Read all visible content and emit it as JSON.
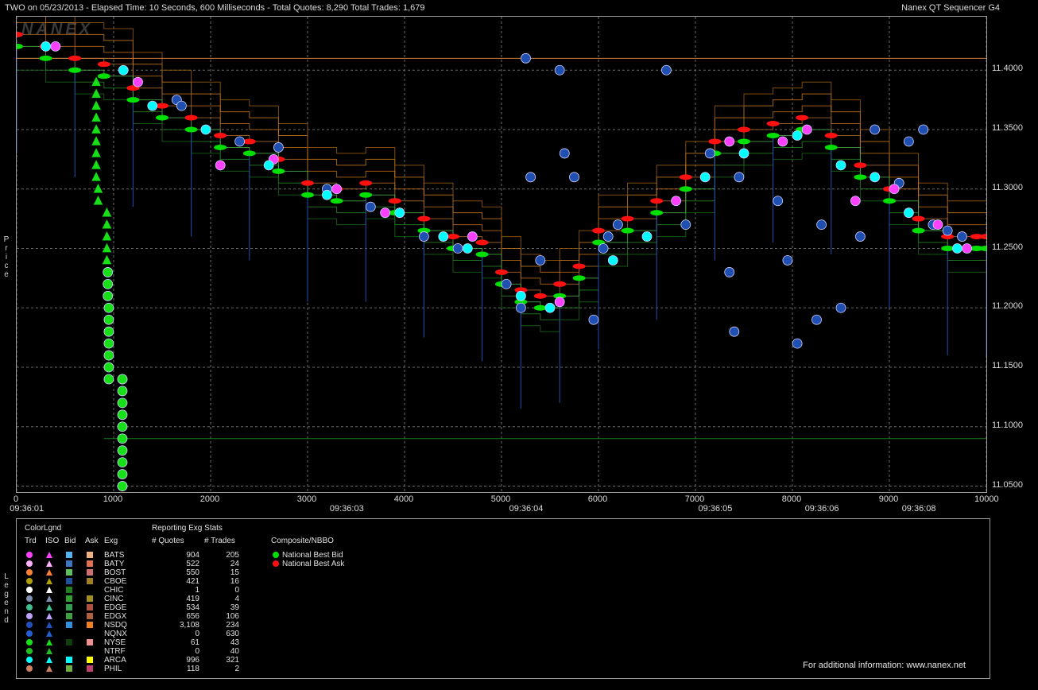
{
  "header": {
    "title": "TWO on 05/23/2013  -  Elapsed Time: 10 Seconds, 600 Milliseconds  -  Total Quotes: 8,290  Total Trades: 1,679",
    "app": "Nanex QT Sequencer G4"
  },
  "side_labels": {
    "price": "Price",
    "legend": "Legend"
  },
  "watermark": "NANEX",
  "chart_data": {
    "type": "scatter",
    "title": "",
    "xlabel": "",
    "ylabel": "Price",
    "xlim": [
      0,
      10000
    ],
    "ylim": [
      11.045,
      11.445
    ],
    "x_ticks": [
      0,
      1000,
      2000,
      3000,
      4000,
      5000,
      6000,
      7000,
      8000,
      9000,
      10000
    ],
    "y_ticks": [
      11.05,
      11.1,
      11.15,
      11.2,
      11.25,
      11.3,
      11.35,
      11.4
    ],
    "y_tick_labels": [
      "11.0500",
      "11.1000",
      "11.1500",
      "11.2000",
      "11.2500",
      "11.3000",
      "11.3500",
      "11.4000"
    ],
    "time_labels": [
      {
        "x": 150,
        "label": "09:36:01"
      },
      {
        "x": 3450,
        "label": "09:36:03"
      },
      {
        "x": 5300,
        "label": "09:36:04"
      },
      {
        "x": 7250,
        "label": "09:36:05"
      },
      {
        "x": 8350,
        "label": "09:36:06"
      },
      {
        "x": 9350,
        "label": "09:36:08"
      }
    ],
    "grid": true,
    "series": [
      {
        "name": "National Best Bid",
        "color": "#00e000",
        "x": [
          0,
          300,
          600,
          900,
          1200,
          1500,
          1800,
          2100,
          2400,
          2700,
          3000,
          3300,
          3600,
          3900,
          4200,
          4500,
          4800,
          5000,
          5200,
          5400,
          5600,
          5800,
          6000,
          6300,
          6600,
          6900,
          7200,
          7500,
          7800,
          8100,
          8400,
          8700,
          9000,
          9300,
          9600,
          9900,
          10000
        ],
        "y": [
          11.42,
          11.41,
          11.4,
          11.395,
          11.375,
          11.36,
          11.35,
          11.335,
          11.33,
          11.315,
          11.295,
          11.29,
          11.295,
          11.28,
          11.265,
          11.25,
          11.245,
          11.22,
          11.205,
          11.2,
          11.21,
          11.225,
          11.255,
          11.265,
          11.28,
          11.3,
          11.33,
          11.34,
          11.345,
          11.35,
          11.335,
          11.31,
          11.29,
          11.265,
          11.25,
          11.25,
          11.25
        ]
      },
      {
        "name": "National Best Ask",
        "color": "#ff1010",
        "x": [
          0,
          300,
          600,
          900,
          1200,
          1500,
          1800,
          2100,
          2400,
          2700,
          3000,
          3300,
          3600,
          3900,
          4200,
          4500,
          4800,
          5000,
          5200,
          5400,
          5600,
          5800,
          6000,
          6300,
          6600,
          6900,
          7200,
          7500,
          7800,
          8100,
          8400,
          8700,
          9000,
          9300,
          9600,
          9900,
          10000
        ],
        "y": [
          11.43,
          11.42,
          11.41,
          11.405,
          11.385,
          11.37,
          11.36,
          11.345,
          11.34,
          11.325,
          11.305,
          11.3,
          11.305,
          11.29,
          11.275,
          11.26,
          11.255,
          11.23,
          11.215,
          11.21,
          11.22,
          11.235,
          11.265,
          11.275,
          11.29,
          11.31,
          11.34,
          11.35,
          11.355,
          11.36,
          11.345,
          11.32,
          11.3,
          11.275,
          11.26,
          11.26,
          11.26
        ]
      },
      {
        "name": "NSDQ Trades",
        "color": "#1f4fb0",
        "x": [
          1650,
          1700,
          2300,
          2700,
          3200,
          3650,
          4200,
          4550,
          5050,
          5200,
          5250,
          5300,
          5400,
          5600,
          5650,
          5750,
          5950,
          6050,
          6100,
          6200,
          6700,
          6900,
          7150,
          7350,
          7400,
          7450,
          7850,
          7950,
          8050,
          8250,
          8300,
          8500,
          8700,
          8850,
          9100,
          9200,
          9350,
          9450,
          9600,
          9750
        ],
        "y": [
          11.375,
          11.37,
          11.34,
          11.335,
          11.3,
          11.285,
          11.26,
          11.25,
          11.22,
          11.2,
          11.41,
          11.31,
          11.24,
          11.4,
          11.33,
          11.31,
          11.19,
          11.25,
          11.26,
          11.27,
          11.4,
          11.27,
          11.33,
          11.23,
          11.18,
          11.31,
          11.29,
          11.24,
          11.17,
          11.19,
          11.27,
          11.2,
          11.26,
          11.35,
          11.305,
          11.34,
          11.35,
          11.27,
          11.265,
          11.26
        ]
      },
      {
        "name": "BATS Trades",
        "color": "#ff40ff",
        "x": [
          400,
          1250,
          2100,
          2650,
          3300,
          3800,
          4700,
          5600,
          6800,
          7350,
          7900,
          8150,
          8650,
          9050,
          9500,
          9800
        ],
        "y": [
          11.42,
          11.39,
          11.32,
          11.325,
          11.3,
          11.28,
          11.26,
          11.205,
          11.29,
          11.34,
          11.34,
          11.35,
          11.29,
          11.3,
          11.27,
          11.25
        ]
      },
      {
        "name": "ARCA Trades",
        "color": "#00ffff",
        "x": [
          300,
          1100,
          1400,
          1950,
          2600,
          3200,
          3950,
          4400,
          4650,
          5200,
          5500,
          6150,
          6500,
          7100,
          7500,
          8050,
          8500,
          8850,
          9200,
          9700
        ],
        "y": [
          11.42,
          11.4,
          11.37,
          11.35,
          11.32,
          11.295,
          11.28,
          11.26,
          11.25,
          11.21,
          11.2,
          11.24,
          11.26,
          11.31,
          11.33,
          11.345,
          11.32,
          11.31,
          11.28,
          11.25
        ]
      },
      {
        "name": "NYSE Trades",
        "color": "#18e018",
        "x": [
          940,
          940,
          940,
          950,
          950,
          950,
          950,
          950,
          950,
          950,
          1090,
          1090,
          1090,
          1090,
          1090,
          1090,
          1090,
          1090,
          1090,
          1090,
          1090,
          1090
        ],
        "y": [
          11.23,
          11.22,
          11.21,
          11.2,
          11.19,
          11.18,
          11.17,
          11.16,
          11.15,
          11.14,
          11.14,
          11.13,
          11.12,
          11.11,
          11.1,
          11.09,
          11.08,
          11.07,
          11.06,
          11.05,
          11.14,
          11.05
        ]
      },
      {
        "name": "NYSE ISO",
        "color": "#18e018",
        "x": [
          820,
          820,
          820,
          820,
          820,
          820,
          820,
          820,
          820,
          840,
          840,
          930,
          930,
          930,
          930,
          930
        ],
        "y": [
          11.39,
          11.38,
          11.37,
          11.36,
          11.35,
          11.34,
          11.33,
          11.32,
          11.31,
          11.3,
          11.29,
          11.28,
          11.27,
          11.26,
          11.25,
          11.24
        ]
      }
    ]
  },
  "legend": {
    "section_title": "ColorLgnd",
    "columns": [
      "Trd",
      "ISO",
      "Bid",
      "Ask",
      "Exg"
    ],
    "stats_title": "Reporting Exg Stats",
    "stats_columns": [
      "# Quotes",
      "# Trades"
    ],
    "composite_title": "Composite/NBBO",
    "composite_items": [
      {
        "label": "National Best Bid",
        "color": "#00e000"
      },
      {
        "label": "National Best Ask",
        "color": "#ff1010"
      }
    ],
    "rows": [
      {
        "exg": "BATS",
        "quotes": "904",
        "trades": "205",
        "trd": "#ff40ff",
        "iso": "#ff40ff",
        "bid": "#4fb4f0",
        "ask": "#f0b080"
      },
      {
        "exg": "BATY",
        "quotes": "522",
        "trades": "24",
        "trd": "#ffb0ff",
        "iso": "#ffb0ff",
        "bid": "#3a78c0",
        "ask": "#e07050"
      },
      {
        "exg": "BOST",
        "quotes": "550",
        "trades": "15",
        "trd": "#ff8030",
        "iso": "#ff8030",
        "bid": "#60c060",
        "ask": "#d07070"
      },
      {
        "exg": "CBOE",
        "quotes": "421",
        "trades": "16",
        "trd": "#b0a000",
        "iso": "#b0a000",
        "bid": "#2050a0",
        "ask": "#a08020"
      },
      {
        "exg": "CHIC",
        "quotes": "1",
        "trades": "0",
        "trd": "#ffffff",
        "iso": "#ffffff",
        "bid": "#208020",
        "ask": "#000000"
      },
      {
        "exg": "CINC",
        "quotes": "419",
        "trades": "4",
        "trd": "#8090b0",
        "iso": "#8090b0",
        "bid": "#30a030",
        "ask": "#a09020"
      },
      {
        "exg": "EDGE",
        "quotes": "534",
        "trades": "39",
        "trd": "#40c090",
        "iso": "#40c090",
        "bid": "#30a050",
        "ask": "#b05040"
      },
      {
        "exg": "EDGX",
        "quotes": "656",
        "trades": "106",
        "trd": "#c0a0ff",
        "iso": "#c0a0ff",
        "bid": "#40a040",
        "ask": "#b06040"
      },
      {
        "exg": "NSDQ",
        "quotes": "3,108",
        "trades": "234",
        "trd": "#2050c0",
        "iso": "#2050c0",
        "bid": "#3090e0",
        "ask": "#f08020"
      },
      {
        "exg": "NQNX",
        "quotes": "0",
        "trades": "630",
        "trd": "#2060d0",
        "iso": "#2060d0",
        "bid": "#000000",
        "ask": "#000000"
      },
      {
        "exg": "NYSE",
        "quotes": "61",
        "trades": "43",
        "trd": "#18e018",
        "iso": "#18e018",
        "bid": "#104010",
        "ask": "#f09090"
      },
      {
        "exg": "NTRF",
        "quotes": "0",
        "trades": "40",
        "trd": "#20c020",
        "iso": "#20c020",
        "bid": "#000000",
        "ask": "#000000"
      },
      {
        "exg": "ARCA",
        "quotes": "996",
        "trades": "321",
        "trd": "#00ffff",
        "iso": "#00ffff",
        "bid": "#00ffff",
        "ask": "#ffff00"
      },
      {
        "exg": "PHIL",
        "quotes": "118",
        "trades": "2",
        "trd": "#d08060",
        "iso": "#d08060",
        "bid": "#70b040",
        "ask": "#c04070"
      }
    ]
  },
  "footer": "For additional information: www.nanex.net"
}
